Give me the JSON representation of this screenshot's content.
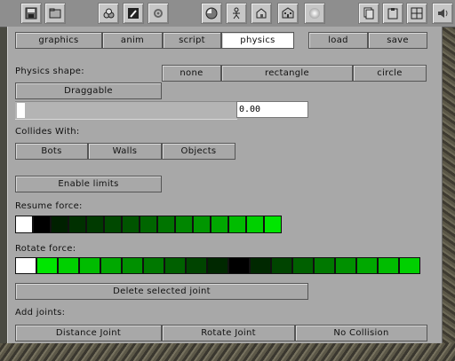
{
  "toolbar": {
    "buttons": [
      {
        "icon": "save-icon"
      },
      {
        "icon": "folder-icon"
      },
      {
        "icon": "shapes-icon"
      },
      {
        "icon": "brush-icon"
      },
      {
        "icon": "gear-icon"
      },
      {
        "icon": "circle-shape-icon"
      },
      {
        "icon": "person-icon"
      },
      {
        "icon": "house-icon"
      },
      {
        "icon": "building-icon"
      },
      {
        "icon": "light-icon"
      },
      {
        "icon": "copy-icon"
      },
      {
        "icon": "paste-icon"
      },
      {
        "icon": "grid-icon"
      },
      {
        "icon": "speaker-icon"
      }
    ]
  },
  "tabs": [
    {
      "label": "graphics",
      "active": false
    },
    {
      "label": "anim",
      "active": false
    },
    {
      "label": "script",
      "active": false
    },
    {
      "label": "physics",
      "active": true
    }
  ],
  "file_buttons": {
    "load": "load",
    "save": "save"
  },
  "physics_shape": {
    "label": "Physics shape:",
    "options": [
      "none",
      "rectangle",
      "circle"
    ]
  },
  "draggable_button": "Draggable",
  "slider": {
    "value_text": "0.00",
    "fraction": 0.0
  },
  "collides": {
    "label": "Collides With:",
    "options": [
      "Bots",
      "Walls",
      "Objects"
    ]
  },
  "enable_limits_button": "Enable limits",
  "resume_force": {
    "label": "Resume force:",
    "colors": [
      "#ffffff",
      "#000000",
      "#002000",
      "#003000",
      "#003a00",
      "#004800",
      "#005400",
      "#006600",
      "#007400",
      "#008600",
      "#009600",
      "#00a800",
      "#00bc00",
      "#00d000",
      "#00e600"
    ]
  },
  "rotate_force": {
    "label": "Rotate force:",
    "colors": [
      "#ffffff",
      "#00e600",
      "#00d000",
      "#00bc00",
      "#00a800",
      "#009000",
      "#007800",
      "#006000",
      "#004400",
      "#002800",
      "#000000",
      "#002800",
      "#004400",
      "#006000",
      "#007800",
      "#009000",
      "#00a800",
      "#00bc00",
      "#00d000"
    ]
  },
  "delete_joint_button": "Delete selected joint",
  "add_joints": {
    "label": "Add joints:",
    "options": [
      "Distance Joint",
      "Rotate Joint",
      "No Collision"
    ]
  },
  "colors": {
    "panel": "#a8a8a8",
    "active_tab": "#ffffff",
    "accent": "#00e600"
  }
}
